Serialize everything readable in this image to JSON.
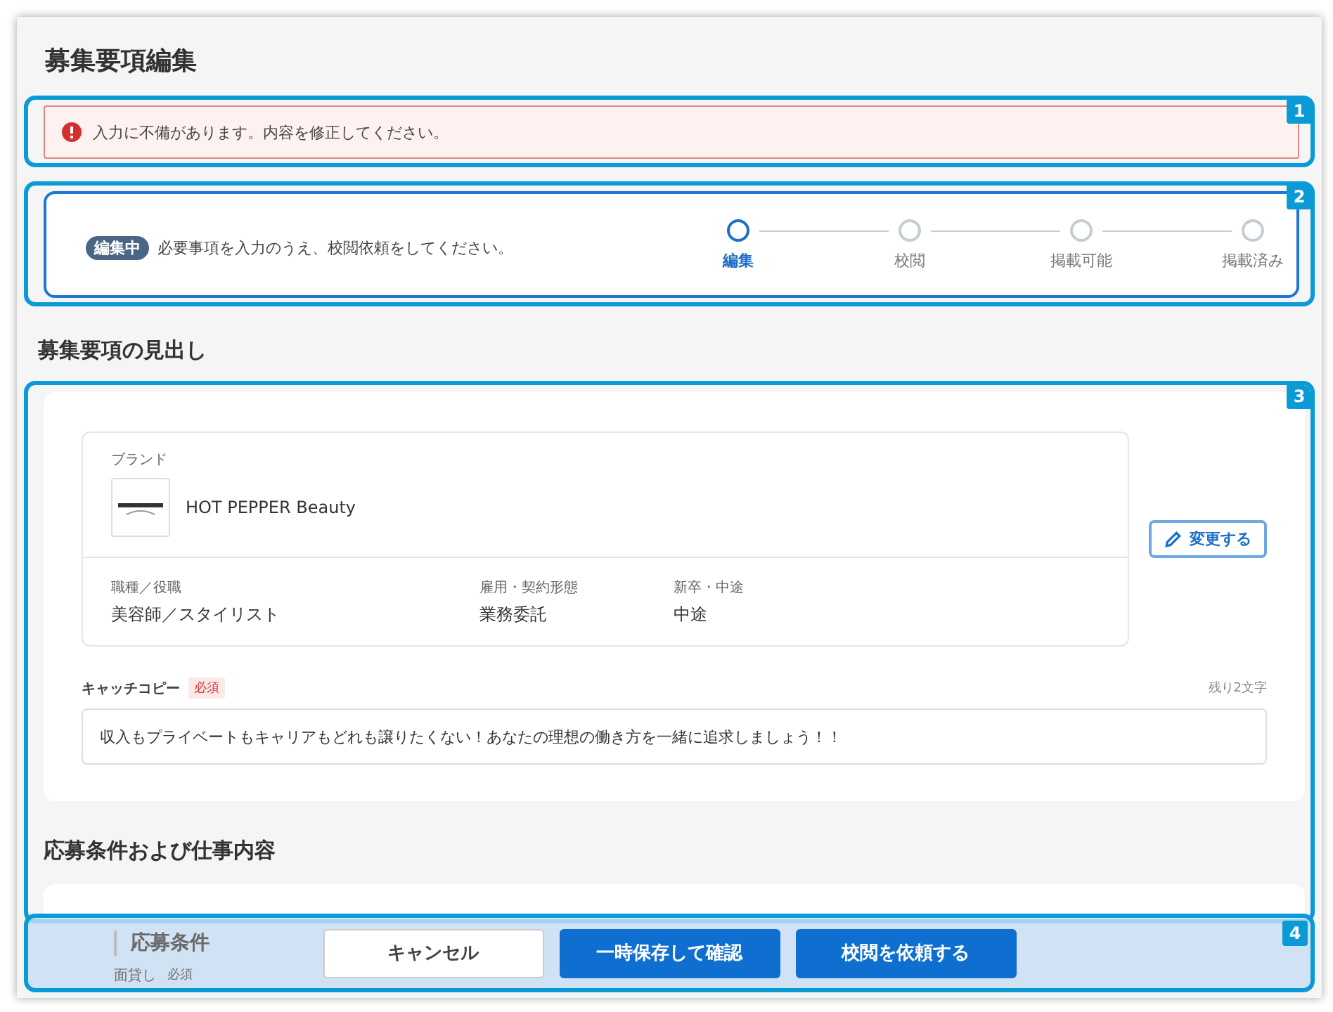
{
  "title": "募集要項編集",
  "error_banner": {
    "callout": "1",
    "message": "入力に不備があります。内容を修正してください。"
  },
  "status_panel": {
    "callout": "2",
    "badge": "編集中",
    "message": "必要事項を入力のうえ、校閲依頼をしてください。",
    "steps": [
      {
        "label": "編集",
        "selected": true
      },
      {
        "label": "校閲",
        "selected": false
      },
      {
        "label": "掲載可能",
        "selected": false
      },
      {
        "label": "掲載済み",
        "selected": false
      }
    ]
  },
  "headline_section": {
    "callout": "3",
    "heading": "募集要項の見出し",
    "brand": {
      "label": "ブランド",
      "name": "HOT PEPPER Beauty"
    },
    "fields": [
      {
        "label": "職種／役職",
        "value": "美容師／スタイリスト"
      },
      {
        "label": "雇用・契約形態",
        "value": "業務委託"
      },
      {
        "label": "新卒・中途",
        "value": "中途"
      }
    ],
    "change_button": "変更する",
    "catch_copy": {
      "label": "キャッチコピー",
      "required_tag": "必須",
      "remaining": "残り2文字",
      "value": "収入もプライベートもキャリアもどれも譲りたくない！あなたの理想の働き方を一緒に追求しましょう！！"
    }
  },
  "conditions_section": {
    "heading": "応募条件および仕事内容",
    "subheading": "応募条件",
    "field_label": "面貸し",
    "required_tag": "必須"
  },
  "footer": {
    "callout": "4",
    "buttons": [
      {
        "label": "キャンセル",
        "kind": "secondary"
      },
      {
        "label": "一時保存して確認",
        "kind": "primary"
      },
      {
        "label": "校閲を依頼する",
        "kind": "primary"
      }
    ]
  }
}
